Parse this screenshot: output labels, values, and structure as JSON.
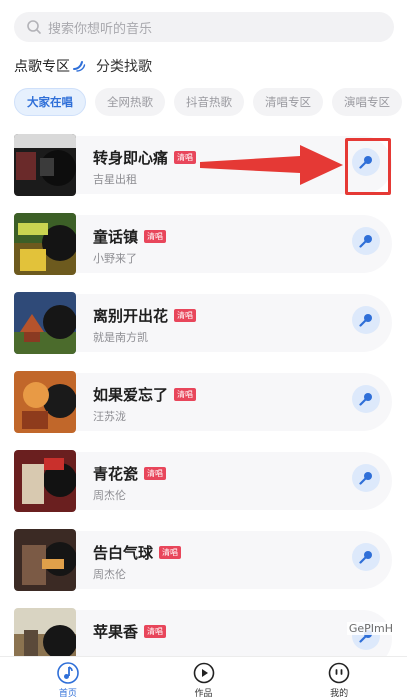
{
  "search": {
    "placeholder": "搜索你想听的音乐"
  },
  "sections": {
    "active": "点歌专区",
    "other": "分类找歌"
  },
  "tabs": [
    "大家在唱",
    "全网热歌",
    "抖音热歌",
    "清唱专区",
    "演唱专区"
  ],
  "songs": [
    {
      "title": "转身即心痛",
      "artist": "吉星出租",
      "badge": "清唱"
    },
    {
      "title": "童话镇",
      "artist": "小野来了",
      "badge": "清唱"
    },
    {
      "title": "离别开出花",
      "artist": "就是南方凯",
      "badge": "清唱"
    },
    {
      "title": "如果爱忘了",
      "artist": "汪苏泷",
      "badge": "清唱"
    },
    {
      "title": "青花瓷",
      "artist": "周杰伦",
      "badge": "清唱"
    },
    {
      "title": "告白气球",
      "artist": "周杰伦",
      "badge": "清唱"
    },
    {
      "title": "苹果香",
      "artist": "",
      "badge": "清唱"
    }
  ],
  "watermark": "GePImH",
  "nav": {
    "home": "首页",
    "works": "作品",
    "mine": "我的"
  },
  "colors": {
    "accent": "#2f6fd8",
    "badge": "#e8465b",
    "annotation": "#e53935"
  }
}
